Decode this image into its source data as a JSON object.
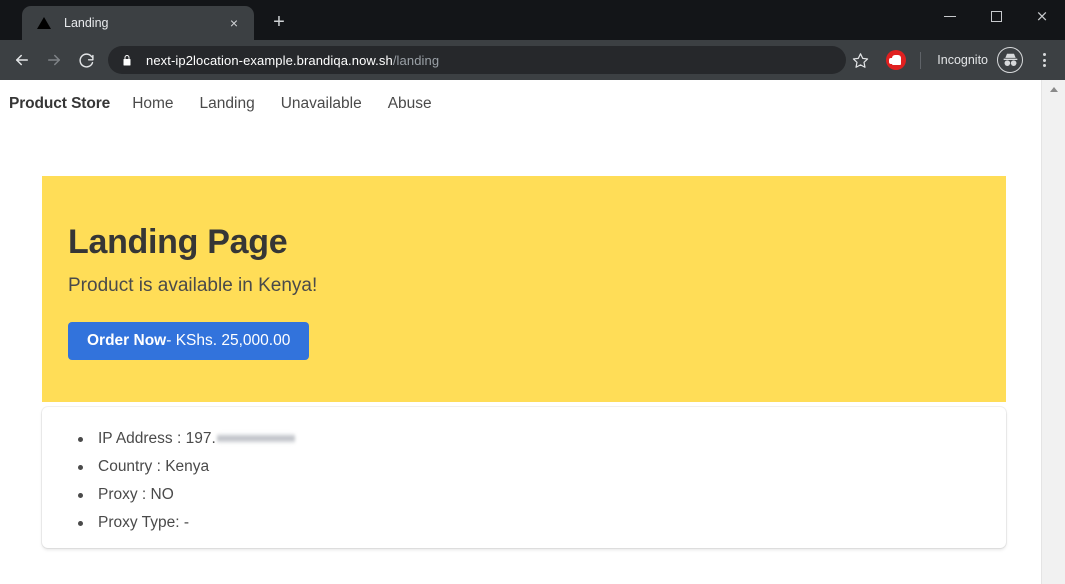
{
  "browser": {
    "tab": {
      "title": "Landing",
      "favicon": "triangle-favicon",
      "close_label": "×"
    },
    "new_tab_label": "+",
    "window_controls": {
      "minimize": "minimize-button",
      "maximize": "maximize-button",
      "close": "×"
    },
    "toolbar": {
      "back": "back-button",
      "forward": "forward-button",
      "reload": "reload-button",
      "lock": "lock-icon",
      "url_domain": "next-ip2location-example.brandiqa.now.sh",
      "url_path": "/landing",
      "bookmark": "star-icon",
      "extension": "adblock-extension-icon",
      "profile_label": "Incognito",
      "profile_icon": "incognito-icon",
      "menu": "three-dot-menu"
    }
  },
  "page": {
    "nav": {
      "brand": "Product Store",
      "links": [
        {
          "label": "Home"
        },
        {
          "label": "Landing"
        },
        {
          "label": "Unavailable"
        },
        {
          "label": "Abuse"
        }
      ]
    },
    "hero": {
      "title": "Landing Page",
      "subtitle": "Product is available in Kenya!",
      "button": {
        "strong": "Order Now",
        "rest": "- KShs. 25,000.00"
      },
      "background_color": "#ffdd57",
      "button_color": "#3273dc"
    },
    "info": {
      "items": [
        {
          "label": "IP Address : 197.",
          "redacted": true
        },
        {
          "label": "Country : Kenya",
          "redacted": false
        },
        {
          "label": "Proxy : NO",
          "redacted": false
        },
        {
          "label": "Proxy Type: -",
          "redacted": false
        }
      ]
    }
  }
}
